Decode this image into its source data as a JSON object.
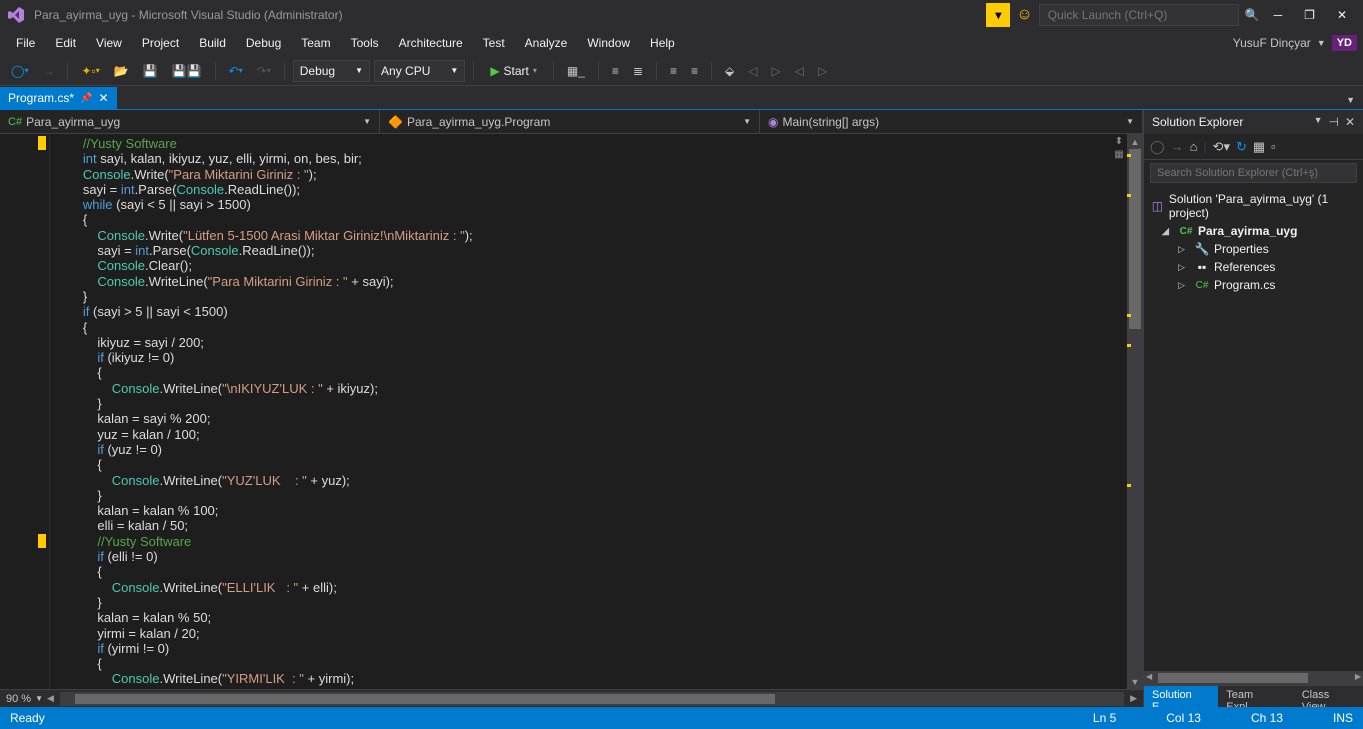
{
  "titlebar": {
    "text": "Para_ayirma_uyg - Microsoft Visual Studio (Administrator)",
    "quicklaunch_placeholder": "Quick Launch (Ctrl+Q)"
  },
  "menubar": {
    "items": [
      "File",
      "Edit",
      "View",
      "Project",
      "Build",
      "Debug",
      "Team",
      "Tools",
      "Architecture",
      "Test",
      "Analyze",
      "Window",
      "Help"
    ],
    "user": "YusuF Dinçyar",
    "user_initials": "YD"
  },
  "toolbar": {
    "config": "Debug",
    "platform": "Any CPU",
    "start": "Start"
  },
  "tabs": {
    "active": "Program.cs*"
  },
  "navbar": {
    "ns": "Para_ayirma_uyg",
    "cls": "Para_ayirma_uyg.Program",
    "method": "Main(string[] args)"
  },
  "code_lines": [
    {
      "i": 0,
      "t": "        //Yusty Software",
      "c": "cmt"
    },
    {
      "i": 0,
      "t": "        int sayi, kalan, ikiyuz, yuz, elli, yirmi, on, bes, bir;",
      "seg": [
        [
          "        ",
          ""
        ],
        [
          "int",
          "kw"
        ],
        [
          " sayi, kalan, ikiyuz, yuz, elli, yirmi, on, bes, bir;",
          ""
        ]
      ]
    },
    {
      "i": 0,
      "seg": [
        [
          "        ",
          ""
        ],
        [
          "Console",
          "cls"
        ],
        [
          ".Write(",
          ""
        ],
        [
          "\"Para Miktarini Giriniz : \"",
          "str"
        ],
        [
          ");",
          ""
        ]
      ]
    },
    {
      "i": 0,
      "seg": [
        [
          "        sayi = ",
          ""
        ],
        [
          "int",
          "kw"
        ],
        [
          ".Parse(",
          ""
        ],
        [
          "Console",
          "cls"
        ],
        [
          ".ReadLine());",
          ""
        ]
      ]
    },
    {
      "i": 0,
      "seg": [
        [
          "        ",
          ""
        ],
        [
          "while",
          "kw"
        ],
        [
          " (sayi < 5 || sayi > 1500)",
          ""
        ]
      ]
    },
    {
      "i": 0,
      "t": "        {"
    },
    {
      "i": 0,
      "seg": [
        [
          "            ",
          ""
        ],
        [
          "Console",
          "cls"
        ],
        [
          ".Write(",
          ""
        ],
        [
          "\"Lütfen 5-1500 Arasi Miktar Giriniz!\\nMiktariniz : \"",
          "str"
        ],
        [
          ");",
          ""
        ]
      ]
    },
    {
      "i": 0,
      "seg": [
        [
          "            sayi = ",
          ""
        ],
        [
          "int",
          "kw"
        ],
        [
          ".Parse(",
          ""
        ],
        [
          "Console",
          "cls"
        ],
        [
          ".ReadLine());",
          ""
        ]
      ]
    },
    {
      "i": 0,
      "seg": [
        [
          "            ",
          ""
        ],
        [
          "Console",
          "cls"
        ],
        [
          ".Clear();",
          ""
        ]
      ]
    },
    {
      "i": 0,
      "seg": [
        [
          "            ",
          ""
        ],
        [
          "Console",
          "cls"
        ],
        [
          ".WriteLine(",
          ""
        ],
        [
          "\"Para Miktarini Giriniz : \"",
          "str"
        ],
        [
          " + sayi);",
          ""
        ]
      ]
    },
    {
      "i": 0,
      "t": "        }"
    },
    {
      "i": 0,
      "seg": [
        [
          "        ",
          ""
        ],
        [
          "if",
          "kw"
        ],
        [
          " (sayi > 5 || sayi < 1500)",
          ""
        ]
      ]
    },
    {
      "i": 0,
      "t": "        {"
    },
    {
      "i": 0,
      "t": "            ikiyuz = sayi / 200;"
    },
    {
      "i": 0,
      "seg": [
        [
          "            ",
          ""
        ],
        [
          "if",
          "kw"
        ],
        [
          " (ikiyuz != 0)",
          ""
        ]
      ]
    },
    {
      "i": 0,
      "t": "            {"
    },
    {
      "i": 0,
      "seg": [
        [
          "                ",
          ""
        ],
        [
          "Console",
          "cls"
        ],
        [
          ".WriteLine(",
          ""
        ],
        [
          "\"\\nIKIYUZ'LUK : \"",
          "str"
        ],
        [
          " + ikiyuz);",
          ""
        ]
      ]
    },
    {
      "i": 0,
      "t": "            }"
    },
    {
      "i": 0,
      "t": "            kalan = sayi % 200;"
    },
    {
      "i": 0,
      "t": "            yuz = kalan / 100;"
    },
    {
      "i": 0,
      "seg": [
        [
          "            ",
          ""
        ],
        [
          "if",
          "kw"
        ],
        [
          " (yuz != 0)",
          ""
        ]
      ]
    },
    {
      "i": 0,
      "t": "            {"
    },
    {
      "i": 0,
      "seg": [
        [
          "                ",
          ""
        ],
        [
          "Console",
          "cls"
        ],
        [
          ".WriteLine(",
          ""
        ],
        [
          "\"YUZ'LUK    : \"",
          "str"
        ],
        [
          " + yuz);",
          ""
        ]
      ]
    },
    {
      "i": 0,
      "t": "            }"
    },
    {
      "i": 0,
      "t": "            kalan = kalan % 100;"
    },
    {
      "i": 0,
      "t": "            elli = kalan / 50;"
    },
    {
      "i": 0,
      "t": "            //Yusty Software",
      "c": "cmt"
    },
    {
      "i": 0,
      "seg": [
        [
          "            ",
          ""
        ],
        [
          "if",
          "kw"
        ],
        [
          " (elli != 0)",
          ""
        ]
      ]
    },
    {
      "i": 0,
      "t": "            {"
    },
    {
      "i": 0,
      "seg": [
        [
          "                ",
          ""
        ],
        [
          "Console",
          "cls"
        ],
        [
          ".WriteLine(",
          ""
        ],
        [
          "\"ELLI'LIK   : \"",
          "str"
        ],
        [
          " + elli);",
          ""
        ]
      ]
    },
    {
      "i": 0,
      "t": "            }"
    },
    {
      "i": 0,
      "t": "            kalan = kalan % 50;"
    },
    {
      "i": 0,
      "t": "            yirmi = kalan / 20;"
    },
    {
      "i": 0,
      "seg": [
        [
          "            ",
          ""
        ],
        [
          "if",
          "kw"
        ],
        [
          " (yirmi != 0)",
          ""
        ]
      ]
    },
    {
      "i": 0,
      "t": "            {"
    },
    {
      "i": 0,
      "seg": [
        [
          "                ",
          ""
        ],
        [
          "Console",
          "cls"
        ],
        [
          ".WriteLine(",
          ""
        ],
        [
          "\"YIRMI'LIK  : \"",
          "str"
        ],
        [
          " + yirmi);",
          ""
        ]
      ]
    }
  ],
  "margin_marks": [
    0,
    26
  ],
  "panel": {
    "title": "Solution Explorer",
    "search_placeholder": "Search Solution Explorer (Ctrl+ş)",
    "solution": "Solution 'Para_ayirma_uyg' (1 project)",
    "project": "Para_ayirma_uyg",
    "nodes": [
      "Properties",
      "References",
      "Program.cs"
    ],
    "tabs": [
      "Solution E...",
      "Team Expl...",
      "Class View"
    ]
  },
  "footer": {
    "zoom": "90 %"
  },
  "status": {
    "ready": "Ready",
    "ln": "Ln 5",
    "col": "Col 13",
    "ch": "Ch 13",
    "ins": "INS"
  }
}
